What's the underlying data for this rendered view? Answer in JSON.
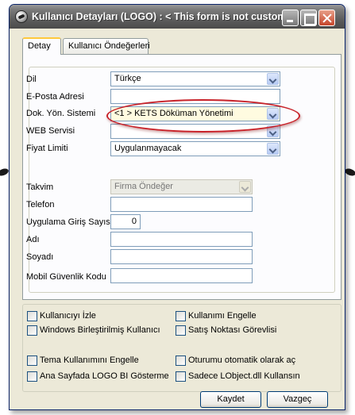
{
  "window": {
    "title": "Kullanıcı Detayları (LOGO) : < This form is not customiza"
  },
  "tabs": [
    {
      "label": "Detay"
    },
    {
      "label": "Kullanıcı Öndeğerleri"
    }
  ],
  "form": {
    "dil": {
      "label": "Dil",
      "value": "Türkçe"
    },
    "eposta": {
      "label": "E-Posta Adresi",
      "value": ""
    },
    "dok_yon": {
      "label": "Dok. Yön. Sistemi",
      "value": "<1 > KETS Döküman Yönetimi"
    },
    "web_servisi": {
      "label": "WEB Servisi",
      "value": ""
    },
    "fiyat_limiti": {
      "label": "Fiyat Limiti",
      "value": "Uygulanmayacak"
    },
    "takvim": {
      "label": "Takvim",
      "value": "Firma Öndeğer"
    },
    "telefon": {
      "label": "Telefon",
      "value": ""
    },
    "giris_sayisi": {
      "label": "Uygulama Giriş Sayısı",
      "value": "0"
    },
    "adi": {
      "label": "Adı",
      "value": ""
    },
    "soyadi": {
      "label": "Soyadı",
      "value": ""
    },
    "mobil_kod": {
      "label": "Mobil Güvenlik Kodu",
      "value": ""
    }
  },
  "options": [
    {
      "label": "Kullanıcıyı İzle",
      "checked": false
    },
    {
      "label": "Kullanımı Engelle",
      "checked": false
    },
    {
      "label": "Windows Birleştirilmiş Kullanıcı",
      "checked": false
    },
    {
      "label": "Satış Noktası Görevlisi",
      "checked": false
    },
    {
      "label": "Tema Kullanımını Engelle",
      "checked": false
    },
    {
      "label": "Oturumu otomatik olarak aç",
      "checked": false
    },
    {
      "label": "Ana Sayfada LOGO BI Gösterme",
      "checked": false
    },
    {
      "label": "Sadece LObject.dll Kullansın",
      "checked": false
    }
  ],
  "buttons": {
    "ok": "Kaydet",
    "cancel": "Vazgeç"
  },
  "colors": {
    "highlight": "#c8232a",
    "tab_accent": "#ffc83c",
    "field_border": "#7f9db9"
  }
}
